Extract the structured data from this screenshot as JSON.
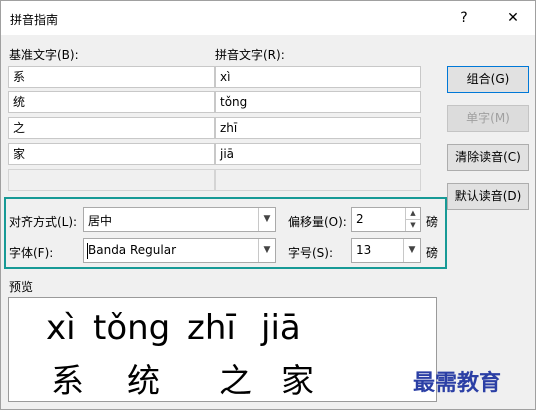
{
  "window": {
    "title": "拼音指南",
    "help": "?",
    "close": "✕"
  },
  "labels": {
    "base_text": "基准文字(B):",
    "pinyin_text": "拼音文字(R):",
    "alignment": "对齐方式(L):",
    "offset": "偏移量(O):",
    "font": "字体(F):",
    "size": "字号(S):",
    "unit1": "磅",
    "unit2": "磅",
    "preview": "预览"
  },
  "rows": [
    {
      "base": "系",
      "pinyin": "xì"
    },
    {
      "base": "统",
      "pinyin": "tǒng"
    },
    {
      "base": "之",
      "pinyin": "zhī"
    },
    {
      "base": "家",
      "pinyin": "jiā"
    },
    {
      "base": "",
      "pinyin": ""
    }
  ],
  "buttons": {
    "combine": "组合(G)",
    "single": "单字(M)",
    "clear": "清除读音(C)",
    "default": "默认读音(D)"
  },
  "fields": {
    "alignment_value": "居中",
    "offset_value": "2",
    "font_value": "Banda Regular",
    "size_value": "13"
  },
  "preview": {
    "pinyin": [
      "xì",
      "tǒng",
      "zhī",
      "jiā"
    ],
    "chars": [
      "系",
      "统",
      "之",
      "家"
    ]
  },
  "watermark": "最需教育",
  "colors": {
    "highlight": "#179a96",
    "watermark": "#2b3fa5"
  }
}
